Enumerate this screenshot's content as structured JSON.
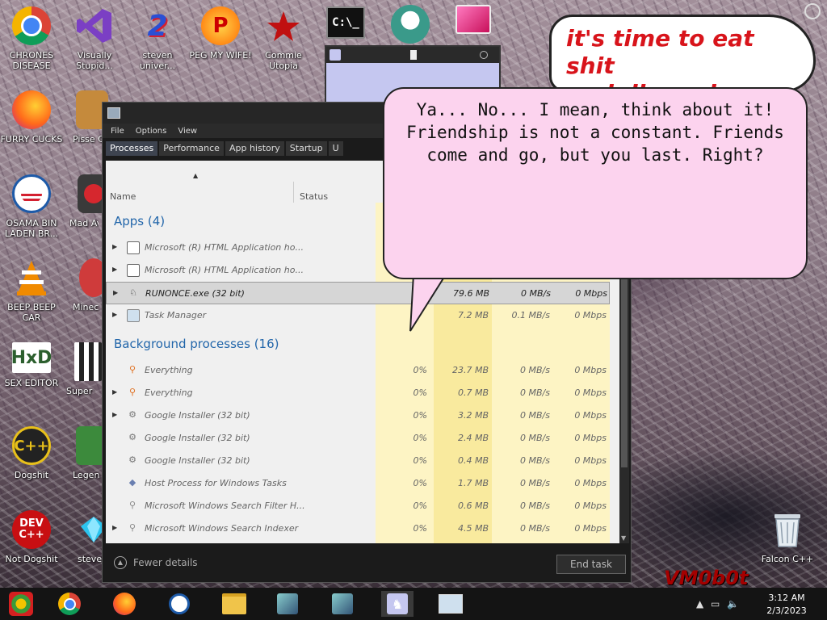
{
  "desktop": {
    "icons": [
      {
        "label": "CHRONES DISEASE",
        "icon": "chrome-icon"
      },
      {
        "label": "Visually Stupid...",
        "icon": "visual-studio-icon"
      },
      {
        "label": "steven univer...",
        "icon": "steven-universe-icon"
      },
      {
        "label": "PEG MY WIFE!",
        "icon": "peggle-icon"
      },
      {
        "label": "Commie Utopia",
        "icon": "commie-icon"
      },
      {
        "label": "FURRY CUCKS",
        "icon": "firefox-icon"
      },
      {
        "label": "Pisse Chicke",
        "icon": "chicken-icon"
      },
      {
        "label": "OSAMA BIN LADEN BR...",
        "icon": "obama-icon"
      },
      {
        "label": "Mad Av IN SPA",
        "icon": "angry-birds-icon"
      },
      {
        "label": "BEEP BEEP CAR",
        "icon": "vlc-icon"
      },
      {
        "label": "Minec Bird",
        "icon": "minecraft-bird-icon"
      },
      {
        "label": "SEX EDITOR",
        "icon": "hxd-icon"
      },
      {
        "label": "Super C",
        "icon": "super-c-icon"
      },
      {
        "label": "Dogshit",
        "icon": "dogshit-icon"
      },
      {
        "label": "Legen CRYAI",
        "icon": "legend-icon"
      },
      {
        "label": "Not Dogshit",
        "icon": "devcpp-icon"
      },
      {
        "label": "steve unive",
        "icon": "diamond-icon"
      },
      {
        "label": "Falcon C++",
        "icon": "recycle-bin-icon"
      }
    ],
    "devcpp_text": "DEV C++",
    "hxd_text": "HxD",
    "banner": {
      "line1": "it's time to eat shit",
      "line2a": "and die and",
      "line2b": "celebrate"
    },
    "watermark": "VM0b0t"
  },
  "task_manager": {
    "menu": [
      "File",
      "Options",
      "View"
    ],
    "tabs": [
      "Processes",
      "Performance",
      "App history",
      "Startup",
      "U"
    ],
    "columns": {
      "name": "Name",
      "status": "Status"
    },
    "apps_header": "Apps (4)",
    "apps": [
      {
        "name": "Microsoft (R) HTML Application ho...",
        "cpu": "",
        "mem": "",
        "disk": "",
        "net": "",
        "expand": true
      },
      {
        "name": "Microsoft (R) HTML Application ho...",
        "cpu": "",
        "mem": "",
        "disk": "",
        "net": "",
        "expand": true
      },
      {
        "name": "RUNONCE.exe (32 bit)",
        "cpu": "",
        "mem": "79.6 MB",
        "disk": "0 MB/s",
        "net": "0 Mbps",
        "expand": true,
        "selected": true
      },
      {
        "name": "Task Manager",
        "cpu": "",
        "mem": "7.2 MB",
        "disk": "0.1 MB/s",
        "net": "0 Mbps",
        "expand": true
      }
    ],
    "bg_header": "Background processes (16)",
    "background": [
      {
        "name": "Everything",
        "cpu": "0%",
        "mem": "23.7 MB",
        "disk": "0 MB/s",
        "net": "0 Mbps",
        "expand": false
      },
      {
        "name": "Everything",
        "cpu": "0%",
        "mem": "0.7 MB",
        "disk": "0 MB/s",
        "net": "0 Mbps",
        "expand": true
      },
      {
        "name": "Google Installer (32 bit)",
        "cpu": "0%",
        "mem": "3.2 MB",
        "disk": "0 MB/s",
        "net": "0 Mbps",
        "expand": true
      },
      {
        "name": "Google Installer (32 bit)",
        "cpu": "0%",
        "mem": "2.4 MB",
        "disk": "0 MB/s",
        "net": "0 Mbps",
        "expand": false
      },
      {
        "name": "Google Installer (32 bit)",
        "cpu": "0%",
        "mem": "0.4 MB",
        "disk": "0 MB/s",
        "net": "0 Mbps",
        "expand": false
      },
      {
        "name": "Host Process for Windows Tasks",
        "cpu": "0%",
        "mem": "1.7 MB",
        "disk": "0 MB/s",
        "net": "0 Mbps",
        "expand": false
      },
      {
        "name": "Microsoft Windows Search Filter H...",
        "cpu": "0%",
        "mem": "0.6 MB",
        "disk": "0 MB/s",
        "net": "0 Mbps",
        "expand": false
      },
      {
        "name": "Microsoft Windows Search Indexer",
        "cpu": "0%",
        "mem": "4.5 MB",
        "disk": "0 MB/s",
        "net": "0 Mbps",
        "expand": true
      }
    ],
    "fewer_details": "Fewer details",
    "end_task": "End task"
  },
  "bubble": {
    "line1": "Ya... No... I mean, think about it!",
    "line2": "Friendship is not a constant. Friends",
    "line3": "come and go, but you last. Right?"
  },
  "taskbar": {
    "time": "3:12 AM",
    "date": "2/3/2023"
  }
}
